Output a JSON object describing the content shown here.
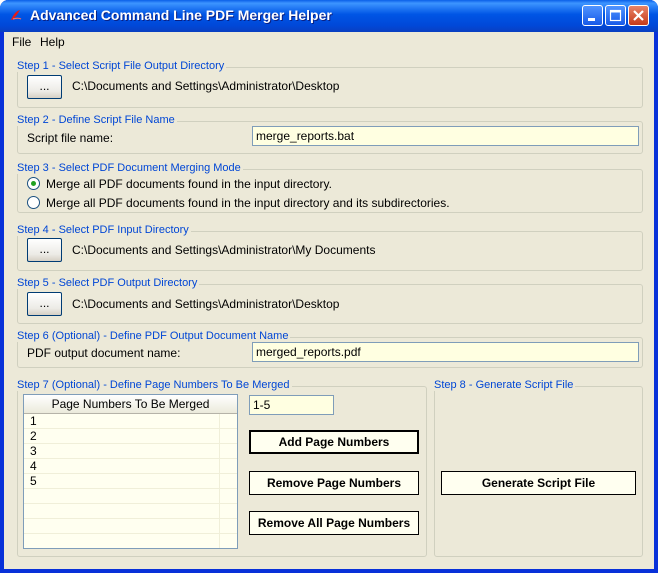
{
  "window": {
    "title": "Advanced Command Line PDF Merger Helper",
    "minimize_icon": "minimize-icon",
    "maximize_icon": "maximize-icon",
    "close_icon": "close-icon",
    "accent": "#0055e5"
  },
  "menu": {
    "items": [
      "File",
      "Help"
    ]
  },
  "step1": {
    "label": "Step 1 - Select Script File Output Directory",
    "browse": "...",
    "path": "C:\\Documents and Settings\\Administrator\\Desktop"
  },
  "step2": {
    "label": "Step 2 - Define Script File Name",
    "field_label": "Script file name:",
    "value": "merge_reports.bat"
  },
  "step3": {
    "label": "Step 3 - Select PDF Document Merging Mode",
    "options": [
      {
        "text": "Merge all PDF documents found in the input directory.",
        "checked": true
      },
      {
        "text": "Merge all PDF documents found in the input directory and its subdirectories.",
        "checked": false
      }
    ]
  },
  "step4": {
    "label": "Step 4 - Select PDF Input Directory",
    "browse": "...",
    "path": "C:\\Documents and Settings\\Administrator\\My Documents"
  },
  "step5": {
    "label": "Step 5 - Select PDF Output Directory",
    "browse": "...",
    "path": "C:\\Documents and Settings\\Administrator\\Desktop"
  },
  "step6": {
    "label": "Step 6 (Optional) - Define PDF Output Document Name",
    "field_label": "PDF output document name:",
    "value": "merged_reports.pdf"
  },
  "step7": {
    "label": "Step 7 (Optional) - Define Page Numbers To Be Merged",
    "list_header": "Page Numbers To Be Merged",
    "pages": [
      "1",
      "2",
      "3",
      "4",
      "5"
    ],
    "range_value": "1-5",
    "add_button": "Add Page Numbers",
    "remove_button": "Remove Page Numbers",
    "remove_all_button": "Remove All Page Numbers"
  },
  "step8": {
    "label": "Step 8 - Generate Script File",
    "generate_button": "Generate Script File"
  }
}
